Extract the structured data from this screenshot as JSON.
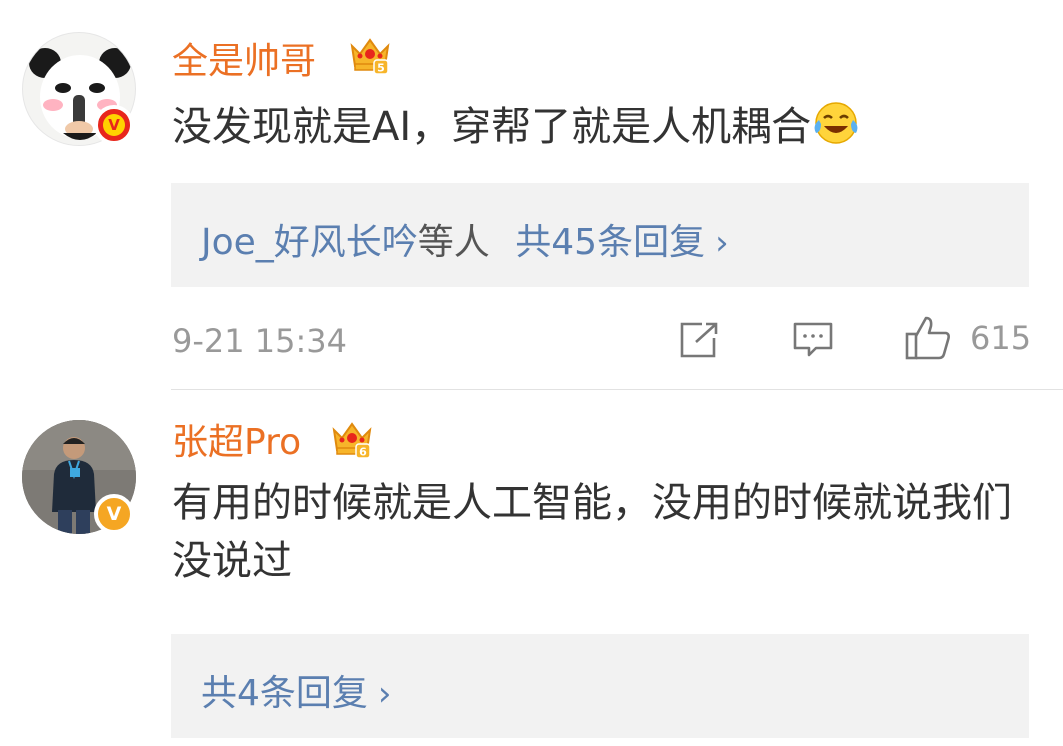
{
  "comments": [
    {
      "username": "全是帅哥",
      "crown_level": "5",
      "text": "没发现就是AI，穿帮了就是人机耦合",
      "emoji": "laughing-tears-icon",
      "reply_link_users": "Joe_好风长吟",
      "reply_link_suffix": "等人",
      "reply_count_text": "共45条回复",
      "chevron": "›",
      "timestamp": "9-21 15:34",
      "like_count": "615",
      "verified_badge": "V",
      "badge_color": "#e8261c"
    },
    {
      "username": "张超Pro",
      "crown_level": "6",
      "text": "有用的时候就是人工智能，没用的时候就说我们没说过",
      "reply_count_text": "共4条回复",
      "chevron": "›",
      "verified_badge": "V",
      "badge_color": "#f5a623"
    }
  ],
  "colors": {
    "username": "#eb7024",
    "link": "#5b7fb0",
    "meta": "#999999",
    "reply_bg": "#f2f2f2"
  }
}
